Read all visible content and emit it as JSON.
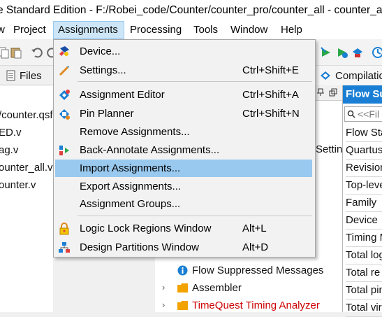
{
  "window": {
    "title": "e Standard Edition - F:/Robei_code/Counter/counter_pro/counter_all - counter_all"
  },
  "menubar": {
    "items": [
      "w",
      "Project",
      "Assignments",
      "Processing",
      "Tools",
      "Window",
      "Help"
    ]
  },
  "left_panel": {
    "tab_label": "Files",
    "files": [
      "/counter.qsf",
      "ED.v",
      "ag.v",
      "ounter_all.v",
      "ounter.v"
    ]
  },
  "middle_panel": {
    "tab_label": "Compilatio",
    "partial_text": "Settin",
    "tree": [
      {
        "label": "Flow Suppressed Messages",
        "icon": "info-icon",
        "color": "#000000"
      },
      {
        "label": "Assembler",
        "icon": "folder-icon",
        "color": "#000000"
      },
      {
        "label": "TimeQuest Timing Analyzer",
        "icon": "folder-icon",
        "color": "#cc0000"
      }
    ]
  },
  "right_panel": {
    "header": "Flow Su",
    "filter_placeholder": "<<Fil",
    "rows": [
      "Flow Sta",
      "Quartus",
      "Revision",
      "Top-leve",
      "Family",
      "Device",
      "Timing M",
      "Total log",
      "Total re",
      "Total pin",
      "Total vir"
    ]
  },
  "assignments_menu": {
    "items": [
      {
        "label": "Device...",
        "shortcut": "",
        "icon": "device-icon"
      },
      {
        "label": "Settings...",
        "shortcut": "Ctrl+Shift+E",
        "icon": "settings-icon"
      },
      {
        "label": "Assignment Editor",
        "shortcut": "Ctrl+Shift+A",
        "icon": "assignment-editor-icon"
      },
      {
        "label": "Pin Planner",
        "shortcut": "Ctrl+Shift+N",
        "icon": "pin-planner-icon"
      },
      {
        "label": "Remove Assignments...",
        "shortcut": "",
        "icon": ""
      },
      {
        "label": "Back-Annotate Assignments...",
        "shortcut": "",
        "icon": "back-annotate-icon"
      },
      {
        "label": "Import Assignments...",
        "shortcut": "",
        "icon": "",
        "highlighted": true
      },
      {
        "label": "Export Assignments...",
        "shortcut": "",
        "icon": ""
      },
      {
        "label": "Assignment Groups...",
        "shortcut": "",
        "icon": ""
      },
      {
        "label": "Logic Lock Regions Window",
        "shortcut": "Alt+L",
        "icon": "logic-lock-icon"
      },
      {
        "label": "Design Partitions Window",
        "shortcut": "Alt+D",
        "icon": "design-partitions-icon"
      }
    ]
  },
  "colors": {
    "accent": "#1a7fd4",
    "menu_highlight": "#99c9ef",
    "error_text": "#cc0000"
  }
}
